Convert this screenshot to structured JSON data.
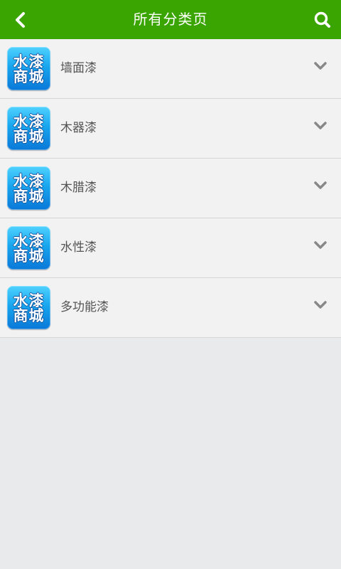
{
  "header": {
    "title": "所有分类页",
    "back_icon": "chevron-left-icon",
    "search_icon": "search-icon",
    "bg_color": "#3aa500"
  },
  "categories": [
    {
      "label": "墙面漆",
      "logo_lines": [
        "水漆",
        "商城"
      ]
    },
    {
      "label": "木器漆",
      "logo_lines": [
        "水漆",
        "商城"
      ]
    },
    {
      "label": "木腊漆",
      "logo_lines": [
        "水漆",
        "商城"
      ]
    },
    {
      "label": "水性漆",
      "logo_lines": [
        "水漆",
        "商城"
      ]
    },
    {
      "label": "多功能漆",
      "logo_lines": [
        "水漆",
        "商城"
      ]
    }
  ]
}
